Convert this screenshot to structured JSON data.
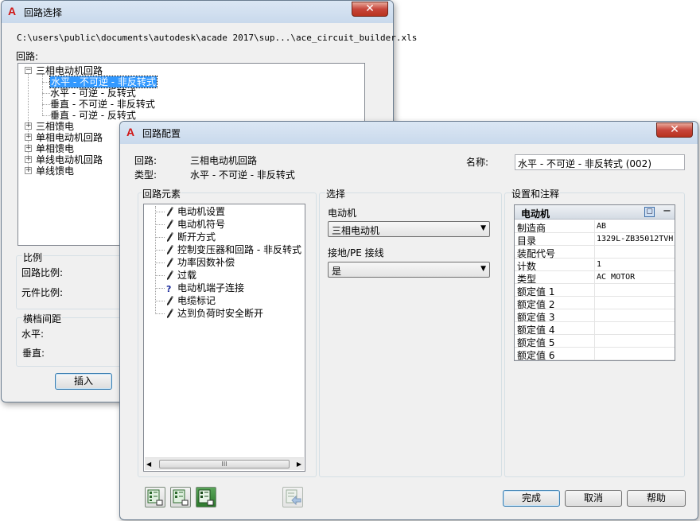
{
  "back_dialog": {
    "title": "回路选择",
    "logo": "A",
    "close": "✕",
    "path": "C:\\users\\public\\documents\\autodesk\\acade 2017\\sup...\\ace_circuit_builder.xls",
    "circuit_label": "回路:",
    "tree": [
      {
        "label": "三相电动机回路",
        "expanded": true
      },
      {
        "label": "水平 - 不可逆 - 非反转式",
        "selected": true
      },
      {
        "label": "水平 - 可逆 - 反转式"
      },
      {
        "label": "垂直 - 不可逆 - 非反转式"
      },
      {
        "label": "垂直 - 可逆 - 反转式"
      },
      {
        "label": "三相馈电"
      },
      {
        "label": "单相电动机回路"
      },
      {
        "label": "单相馈电"
      },
      {
        "label": "单线电动机回路"
      },
      {
        "label": "单线馈电"
      }
    ],
    "scale_group": "比例",
    "circuit_scale": "回路比例:",
    "component_scale": "元件比例:",
    "spacing_group": "横档间距",
    "horizontal": "水平:",
    "vertical": "垂直:",
    "insert_button": "插入"
  },
  "front_dialog": {
    "title": "回路配置",
    "logo": "A",
    "close": "✕",
    "circuit_label": "回路:",
    "circuit_value": "三相电动机回路",
    "type_label": "类型:",
    "type_value": "水平 - 不可逆 - 非反转式",
    "name_label": "名称:",
    "name_value": "水平 - 不可逆 - 非反转式 (002)",
    "elements_group": "回路元素",
    "elements": [
      {
        "label": "电动机设置",
        "icon": "pencil-icon"
      },
      {
        "label": "电动机符号",
        "icon": "pencil-icon"
      },
      {
        "label": "断开方式",
        "icon": "pencil-icon"
      },
      {
        "label": "控制变压器和回路 - 非反转式",
        "icon": "pencil-icon"
      },
      {
        "label": "功率因数补偿",
        "icon": "pencil-icon"
      },
      {
        "label": "过载",
        "icon": "pencil-icon"
      },
      {
        "label": "电动机端子连接",
        "icon": "question-icon"
      },
      {
        "label": "电缆标记",
        "icon": "pencil-icon"
      },
      {
        "label": "达到负荷时安全断开",
        "icon": "pencil-icon"
      }
    ],
    "scroll_grip": "III",
    "selection_group": "选择",
    "motor_label": "电动机",
    "motor_value": "三相电动机",
    "ground_label": "接地/PE 接线",
    "ground_value": "是",
    "settings_group": "设置和注释",
    "props_header": "电动机",
    "props_collapse": "−",
    "props": [
      {
        "name": "制造商",
        "value": "AB"
      },
      {
        "name": "目录",
        "value": "1329L-ZB35012TVH"
      },
      {
        "name": "装配代号",
        "value": ""
      },
      {
        "name": "计数",
        "value": "1"
      },
      {
        "name": "类型",
        "value": "AC MOTOR"
      },
      {
        "name": "额定值 1",
        "value": ""
      },
      {
        "name": "额定值 2",
        "value": ""
      },
      {
        "name": "额定值 3",
        "value": ""
      },
      {
        "name": "额定值 4",
        "value": ""
      },
      {
        "name": "额定值 5",
        "value": ""
      },
      {
        "name": "额定值 6",
        "value": ""
      }
    ],
    "finish_button": "完成",
    "cancel_button": "取消",
    "help_button": "帮助"
  }
}
